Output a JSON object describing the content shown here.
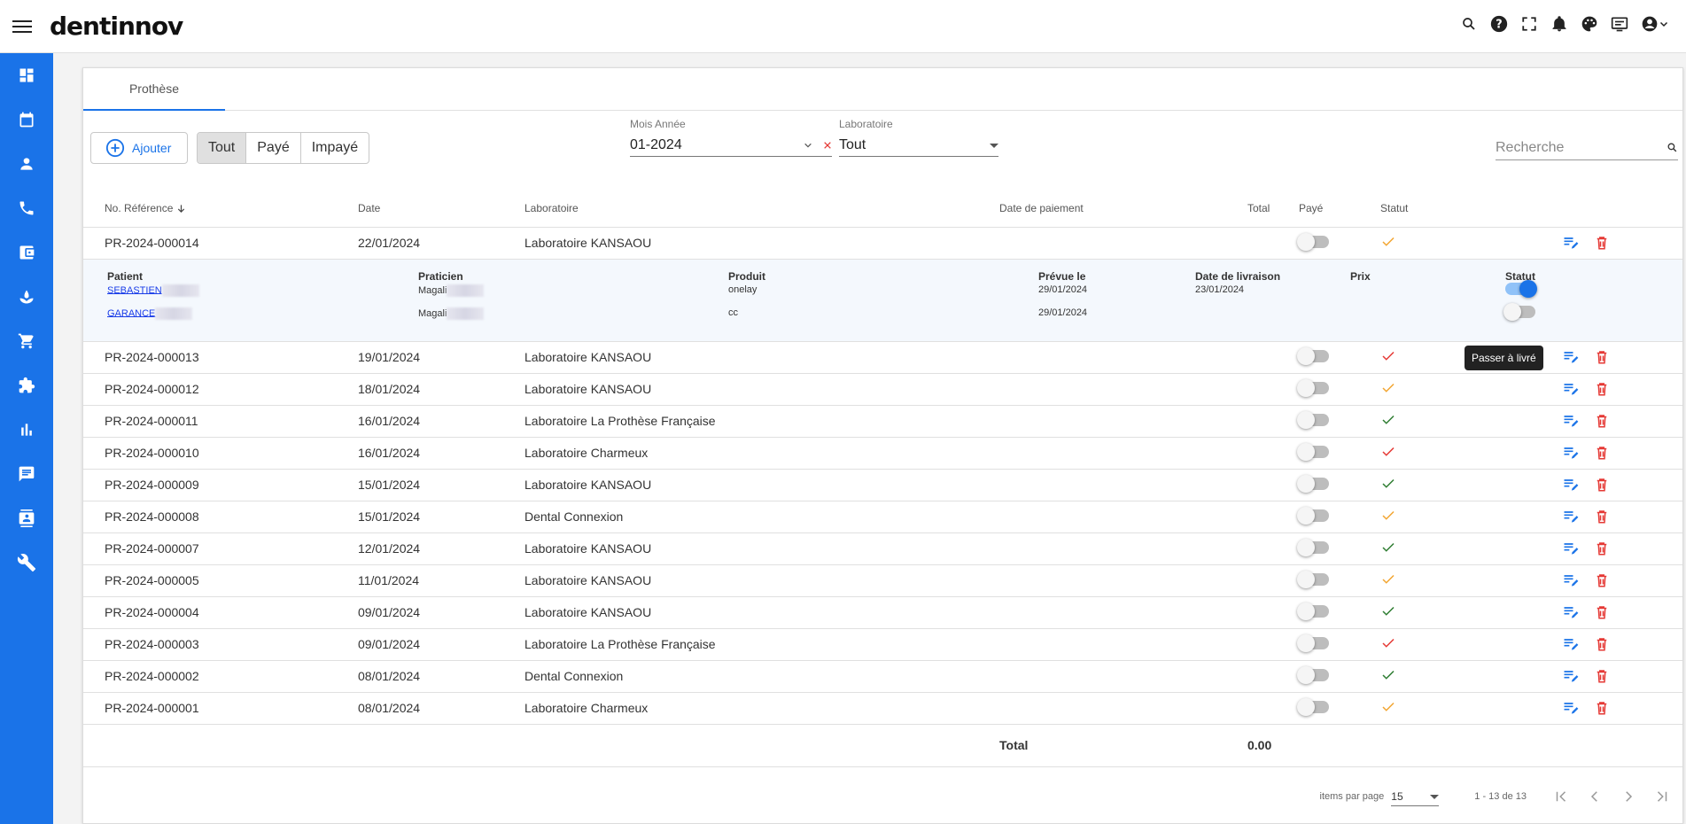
{
  "app": {
    "logo": "dentinnov"
  },
  "tabs": [
    {
      "label": "Prothèse"
    }
  ],
  "toolbar": {
    "add_label": "Ajouter",
    "filters": [
      "Tout",
      "Payé",
      "Impayé"
    ],
    "month_label": "Mois Année",
    "month_value": "01-2024",
    "lab_label": "Laboratoire",
    "lab_value": "Tout",
    "search_placeholder": "Recherche"
  },
  "table": {
    "columns": [
      "No. Référence",
      "Date",
      "Laboratoire",
      "Date de paiement",
      "Total",
      "Payé",
      "Statut"
    ],
    "rows": [
      {
        "ref": "PR-2024-000014",
        "date": "22/01/2024",
        "lab": "Laboratoire KANSAOU",
        "status_color": "#f2a530"
      },
      {
        "ref": "PR-2024-000013",
        "date": "19/01/2024",
        "lab": "Laboratoire KANSAOU",
        "status_color": "#e53935"
      },
      {
        "ref": "PR-2024-000012",
        "date": "18/01/2024",
        "lab": "Laboratoire KANSAOU",
        "status_color": "#f2a530"
      },
      {
        "ref": "PR-2024-000011",
        "date": "16/01/2024",
        "lab": "Laboratoire La Prothèse Française",
        "status_color": "#2e7d32"
      },
      {
        "ref": "PR-2024-000010",
        "date": "16/01/2024",
        "lab": "Laboratoire Charmeux",
        "status_color": "#e53935"
      },
      {
        "ref": "PR-2024-000009",
        "date": "15/01/2024",
        "lab": "Laboratoire KANSAOU",
        "status_color": "#2e7d32"
      },
      {
        "ref": "PR-2024-000008",
        "date": "15/01/2024",
        "lab": "Dental Connexion",
        "status_color": "#f2a530"
      },
      {
        "ref": "PR-2024-000007",
        "date": "12/01/2024",
        "lab": "Laboratoire KANSAOU",
        "status_color": "#2e7d32"
      },
      {
        "ref": "PR-2024-000005",
        "date": "11/01/2024",
        "lab": "Laboratoire KANSAOU",
        "status_color": "#f2a530"
      },
      {
        "ref": "PR-2024-000004",
        "date": "09/01/2024",
        "lab": "Laboratoire KANSAOU",
        "status_color": "#2e7d32"
      },
      {
        "ref": "PR-2024-000003",
        "date": "09/01/2024",
        "lab": "Laboratoire La Prothèse Française",
        "status_color": "#e53935"
      },
      {
        "ref": "PR-2024-000002",
        "date": "08/01/2024",
        "lab": "Dental Connexion",
        "status_color": "#2e7d32"
      },
      {
        "ref": "PR-2024-000001",
        "date": "08/01/2024",
        "lab": "Laboratoire Charmeux",
        "status_color": "#f2a530"
      }
    ],
    "detail": {
      "headers": [
        "Patient",
        "Praticien",
        "Produit",
        "Prévue le",
        "Date de livraison",
        "Prix",
        "Statut"
      ],
      "items": [
        {
          "patient": "SEBASTIEN",
          "praticien": "Magali",
          "produit": "onelay",
          "prevue": "29/01/2024",
          "livraison": "23/01/2024",
          "delivered": true
        },
        {
          "patient": "GARANCE",
          "praticien": "Magali",
          "produit": "cc",
          "prevue": "29/01/2024",
          "livraison": "",
          "delivered": false
        }
      ]
    },
    "total_label": "Total",
    "total_value": "0.00"
  },
  "tooltip": "Passer à livré",
  "pager": {
    "label": "items par page",
    "size": "15",
    "range": "1 - 13 de 13"
  },
  "colors": {
    "primary": "#1a73e8",
    "delete": "#e53935"
  }
}
